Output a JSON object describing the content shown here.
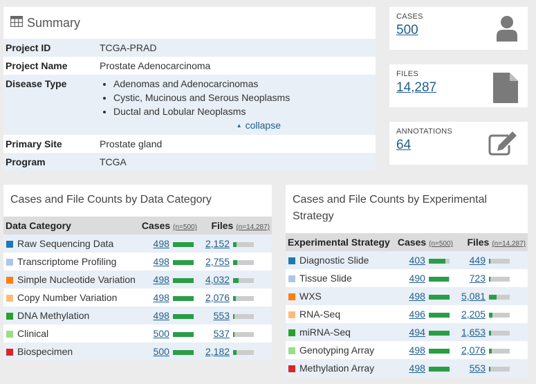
{
  "summary": {
    "title": "Summary",
    "project_id_label": "Project ID",
    "project_id": "TCGA-PRAD",
    "project_name_label": "Project Name",
    "project_name": "Prostate Adenocarcinoma",
    "disease_type_label": "Disease Type",
    "disease_types": [
      "Adenomas and Adenocarcinomas",
      "Cystic, Mucinous and Serous Neoplasms",
      "Ductal and Lobular Neoplasms"
    ],
    "collapse_label": "collapse",
    "primary_site_label": "Primary Site",
    "primary_site": "Prostate gland",
    "program_label": "Program",
    "program": "TCGA"
  },
  "cards": {
    "cases_label": "CASES",
    "cases": "500",
    "files_label": "FILES",
    "files": "14,287",
    "annotations_label": "ANNOTATIONS",
    "annotations": "64"
  },
  "data_category": {
    "title": "Cases and File Counts by Data Category",
    "col_category": "Data Category",
    "col_cases": "Cases",
    "cases_n": "(n=500)",
    "col_files": "Files",
    "files_n": "(n=14,287)",
    "rows": [
      {
        "label": "Raw Sequencing Data",
        "color": "#1f77b4",
        "cases": "498",
        "files": "2,152",
        "cases_pct": 0.996,
        "files_pct": 0.151
      },
      {
        "label": "Transcriptome Profiling",
        "color": "#aec7e8",
        "cases": "498",
        "files": "2,755",
        "cases_pct": 0.996,
        "files_pct": 0.193
      },
      {
        "label": "Simple Nucleotide Variation",
        "color": "#ff7f0e",
        "cases": "498",
        "files": "4,032",
        "cases_pct": 0.996,
        "files_pct": 0.282
      },
      {
        "label": "Copy Number Variation",
        "color": "#ffbb78",
        "cases": "498",
        "files": "2,076",
        "cases_pct": 0.996,
        "files_pct": 0.145
      },
      {
        "label": "DNA Methylation",
        "color": "#2ca02c",
        "cases": "498",
        "files": "553",
        "cases_pct": 0.996,
        "files_pct": 0.039
      },
      {
        "label": "Clinical",
        "color": "#98df8a",
        "cases": "500",
        "files": "537",
        "cases_pct": 1.0,
        "files_pct": 0.038
      },
      {
        "label": "Biospecimen",
        "color": "#d62728",
        "cases": "500",
        "files": "2,182",
        "cases_pct": 1.0,
        "files_pct": 0.153
      }
    ]
  },
  "experimental_strategy": {
    "title": "Cases and File Counts by Experimental Strategy",
    "col_strategy": "Experimental Strategy",
    "col_cases": "Cases",
    "cases_n": "(n=500)",
    "col_files": "Files",
    "files_n": "(n=14,287)",
    "rows": [
      {
        "label": "Diagnostic Slide",
        "color": "#1f77b4",
        "cases": "403",
        "files": "449",
        "cases_pct": 0.806,
        "files_pct": 0.031
      },
      {
        "label": "Tissue Slide",
        "color": "#aec7e8",
        "cases": "490",
        "files": "723",
        "cases_pct": 0.98,
        "files_pct": 0.051
      },
      {
        "label": "WXS",
        "color": "#ff7f0e",
        "cases": "498",
        "files": "5,081",
        "cases_pct": 0.996,
        "files_pct": 0.356
      },
      {
        "label": "RNA-Seq",
        "color": "#ffbb78",
        "cases": "496",
        "files": "2,205",
        "cases_pct": 0.992,
        "files_pct": 0.154
      },
      {
        "label": "miRNA-Seq",
        "color": "#2ca02c",
        "cases": "494",
        "files": "1,653",
        "cases_pct": 0.988,
        "files_pct": 0.116
      },
      {
        "label": "Genotyping Array",
        "color": "#98df8a",
        "cases": "498",
        "files": "2,076",
        "cases_pct": 0.996,
        "files_pct": 0.145
      },
      {
        "label": "Methylation Array",
        "color": "#d62728",
        "cases": "498",
        "files": "553",
        "cases_pct": 0.996,
        "files_pct": 0.039
      }
    ]
  }
}
